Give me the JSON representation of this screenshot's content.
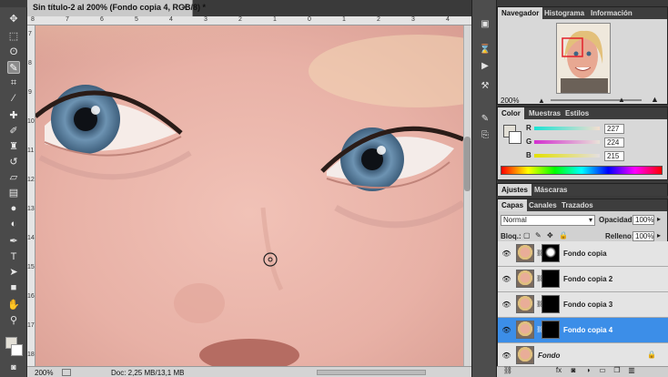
{
  "document": {
    "tab_title": "Sin título-2 al 200% (Fondo copia 4, RGB/8) *",
    "zoom_status": "200%",
    "doc_info": "Doc: 2,25 MB/13,1 MB"
  },
  "rulers": {
    "top": [
      "8",
      "7",
      "6",
      "5",
      "4",
      "3",
      "2",
      "1",
      "0",
      "1",
      "2",
      "3",
      "4"
    ],
    "left": [
      "7",
      "8",
      "9",
      "10",
      "11",
      "12",
      "13",
      "14",
      "15",
      "16",
      "17",
      "18"
    ]
  },
  "tools": [
    "move-icon",
    "marquee-icon",
    "lasso-icon",
    "quick-select-icon",
    "crop-icon",
    "eyedropper-icon",
    "healing-icon",
    "brush-icon",
    "clone-stamp-icon",
    "history-brush-icon",
    "eraser-icon",
    "gradient-icon",
    "blur-icon",
    "dodge-icon",
    "pen-icon",
    "type-icon",
    "path-select-icon",
    "shape-icon",
    "hand-icon",
    "zoom-icon"
  ],
  "navigator": {
    "tabs": [
      "Navegador",
      "Histograma",
      "Información"
    ],
    "zoom": "200%"
  },
  "color": {
    "tabs": [
      "Color",
      "Muestras",
      "Estilos"
    ],
    "channels": [
      {
        "label": "R",
        "value": "227"
      },
      {
        "label": "G",
        "value": "224"
      },
      {
        "label": "B",
        "value": "215"
      }
    ]
  },
  "adjustments": {
    "tabs": [
      "Ajustes",
      "Máscaras"
    ]
  },
  "layers_panel": {
    "tabs": [
      "Capas",
      "Canales",
      "Trazados"
    ],
    "blend_mode": "Normal",
    "opacity_label": "Opacidad:",
    "opacity": "100%",
    "lock_label": "Bloq.:",
    "fill_label": "Relleno:",
    "fill": "100%",
    "layers": [
      {
        "name": "Fondo copia",
        "selected": false
      },
      {
        "name": "Fondo copia 2",
        "selected": false
      },
      {
        "name": "Fondo copia 3",
        "selected": false
      },
      {
        "name": "Fondo copia 4",
        "selected": true
      },
      {
        "name": "Fondo",
        "selected": false
      }
    ]
  },
  "colors": {
    "accent": "#3c8ee8",
    "skin": "#e6b2a9",
    "iris": "#5a7f9e"
  }
}
